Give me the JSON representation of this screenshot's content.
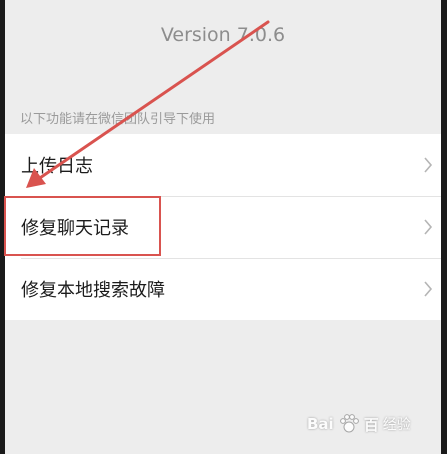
{
  "header": {
    "version_text": "Version 7.0.6"
  },
  "section": {
    "hint_text": "以下功能请在微信团队引导下使用"
  },
  "list": {
    "items": [
      {
        "label": "上传日志"
      },
      {
        "label": "修复聊天记录"
      },
      {
        "label": "修复本地搜索故障"
      }
    ]
  },
  "annotation": {
    "color": "#d9534f"
  },
  "watermark": {
    "brand_a": "Bai",
    "brand_b": "百",
    "brand_c": "经验"
  },
  "icons": {
    "row_chevron": "chevron-right-icon",
    "watermark_logo": "paw-icon"
  }
}
